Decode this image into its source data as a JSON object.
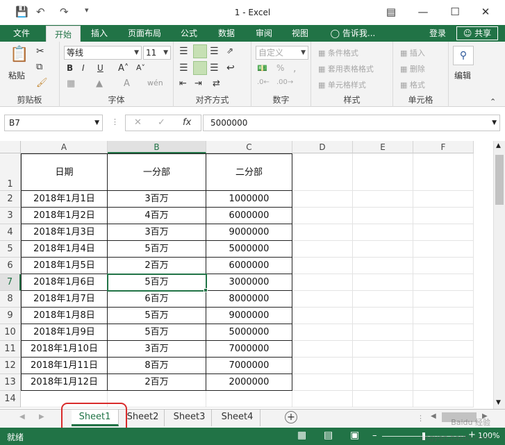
{
  "app": {
    "title": "1 - Excel",
    "accent": "#217346"
  },
  "tabs": [
    "文件",
    "开始",
    "插入",
    "页面布局",
    "公式",
    "数据",
    "审阅",
    "视图"
  ],
  "tell_me": "告诉我...",
  "login": "登录",
  "share": "共享",
  "ribbon": {
    "clipboard": {
      "paste": "粘贴",
      "label": "剪贴板"
    },
    "font": {
      "name": "等线",
      "size": "11",
      "bold": "B",
      "italic": "I",
      "underline": "U",
      "label": "字体"
    },
    "align": {
      "label": "对齐方式"
    },
    "number": {
      "format": "自定义",
      "label": "数字"
    },
    "styles": {
      "cond": "条件格式",
      "table": "套用表格格式",
      "cell": "单元格样式",
      "label": "样式"
    },
    "cells": {
      "insert": "插入",
      "delete": "删除",
      "format": "格式",
      "label": "单元格"
    },
    "edit": {
      "label": "编辑"
    }
  },
  "namebox": "B7",
  "fx": "fx",
  "formula": "5000000",
  "columns": [
    "A",
    "B",
    "C",
    "D",
    "E",
    "F"
  ],
  "header_row": [
    "日期",
    "一分部",
    "二分部"
  ],
  "rows": [
    [
      "2018年1月1日",
      "3百万",
      "1000000"
    ],
    [
      "2018年1月2日",
      "4百万",
      "6000000"
    ],
    [
      "2018年1月3日",
      "3百万",
      "9000000"
    ],
    [
      "2018年1月4日",
      "5百万",
      "5000000"
    ],
    [
      "2018年1月5日",
      "2百万",
      "6000000"
    ],
    [
      "2018年1月6日",
      "5百万",
      "3000000"
    ],
    [
      "2018年1月7日",
      "6百万",
      "8000000"
    ],
    [
      "2018年1月8日",
      "5百万",
      "9000000"
    ],
    [
      "2018年1月9日",
      "5百万",
      "5000000"
    ],
    [
      "2018年1月10日",
      "3百万",
      "7000000"
    ],
    [
      "2018年1月11日",
      "8百万",
      "7000000"
    ],
    [
      "2018年1月12日",
      "2百万",
      "2000000"
    ]
  ],
  "row_numbers": [
    "1",
    "2",
    "3",
    "4",
    "5",
    "6",
    "7",
    "8",
    "9",
    "10",
    "11",
    "12",
    "13",
    "14"
  ],
  "sheets": [
    "Sheet1",
    "Sheet2",
    "Sheet3",
    "Sheet4"
  ],
  "status": {
    "ready": "就绪",
    "zoom": "100%"
  },
  "watermark": "Baidu 经验 jingyan.baidu.com"
}
